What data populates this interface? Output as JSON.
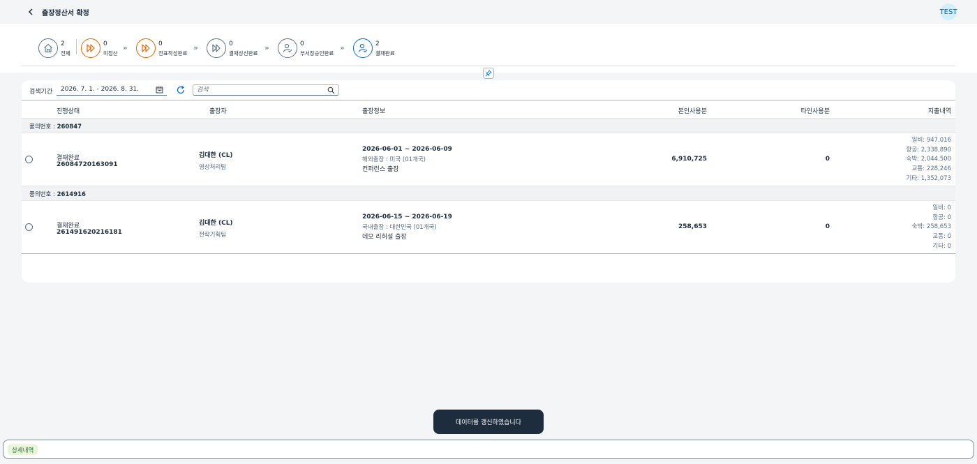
{
  "shell": {
    "title": "출장정산서 확정",
    "user": "TEST"
  },
  "steps": [
    {
      "count": "2",
      "label": "전체",
      "icon": "home-icon"
    },
    {
      "count": "0",
      "label": "미정산",
      "icon": "fast-forward-icon"
    },
    {
      "count": "0",
      "label": "전표작성완료",
      "icon": "fast-forward-icon"
    },
    {
      "count": "0",
      "label": "결재상신완료",
      "icon": "fast-forward-icon"
    },
    {
      "count": "0",
      "label": "부서장승인완료",
      "icon": "user-check-icon"
    },
    {
      "count": "2",
      "label": "결재완료",
      "icon": "user-check-icon"
    }
  ],
  "filter": {
    "period_label": "검색기간",
    "period_value": "2026. 7. 1. - 2026. 8. 31.",
    "search_placeholder": "검색"
  },
  "table": {
    "columns": [
      "진행상태",
      "출장자",
      "출장정보",
      "본인사용분",
      "타인사용분",
      "지출내역"
    ],
    "groups": [
      {
        "label": "품의번호 :",
        "number": "260847",
        "row": {
          "status": "결재완료",
          "doc_no": "26084720163091",
          "traveler": "김대한 (CL)",
          "team": "영상처리팀",
          "period": "2026-06-01 ~ 2026-06-09",
          "trip_type": "해외출장 : 미국 (01개국)",
          "purpose": "컨퍼런스 출장",
          "own_amount": "6,910,725",
          "other_amount": "0",
          "expenses": [
            "일비: 947,016",
            "항공: 2,338,890",
            "숙박: 2,044,500",
            "교통: 228,246",
            "기타: 1,352,073"
          ]
        }
      },
      {
        "label": "품의번호 :",
        "number": "2614916",
        "row": {
          "status": "결재완료",
          "doc_no": "261491620216181",
          "traveler": "김대한 (CL)",
          "team": "전략기획팀",
          "period": "2026-06-15 ~ 2026-06-19",
          "trip_type": "국내출장 : 대한민국 (01개국)",
          "purpose": "데모 리허설 출장",
          "own_amount": "258,653",
          "other_amount": "0",
          "expenses": [
            "일비: 0",
            "항공: 0",
            "숙박: 258,653",
            "교통: 0",
            "기타: 0"
          ]
        }
      }
    ]
  },
  "toast": "데이터를 갱신하였습니다",
  "bottom": {
    "tag": "상세내역"
  },
  "colors": {
    "accent": "#0a6ed1",
    "warning": "#e76500",
    "neutral": "#5b738b",
    "text": "#1d2d3e"
  }
}
